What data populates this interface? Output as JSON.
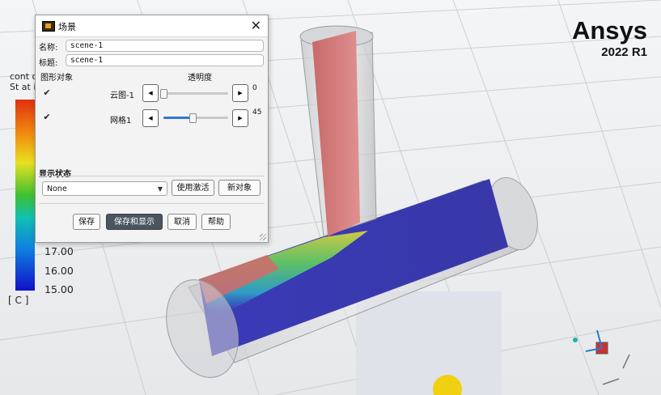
{
  "brand": {
    "name": "Ansys",
    "version": "2022 R1"
  },
  "legend": {
    "title_line1": "cont ou",
    "title_line2": "St at ic",
    "ticks": [
      "17.00",
      "16.00",
      "15.00"
    ],
    "unit": "[ C ]",
    "colors": [
      "#e03010",
      "#f08c10",
      "#e8e020",
      "#40c030",
      "#10c0b0",
      "#1080e0",
      "#1010c8"
    ]
  },
  "dialog": {
    "title": "场景",
    "name_label": "名称:",
    "name_value": "scene-1",
    "title_label": "标题:",
    "title_value": "scene-1",
    "objects_header": "图形对象",
    "transparency_header": "透明度",
    "objects": [
      {
        "label": "云图-1",
        "checked": true,
        "value": "0",
        "fraction": 0.0
      },
      {
        "label": "网格1",
        "checked": true,
        "value": "45",
        "fraction": 0.45
      }
    ],
    "display_state_header": "显示状态",
    "display_state_value": "None",
    "use_active_label": "使用激活",
    "new_object_label": "新对象",
    "buttons": {
      "save": "保存",
      "save_display": "保存和显示",
      "cancel": "取消",
      "help": "帮助"
    }
  }
}
